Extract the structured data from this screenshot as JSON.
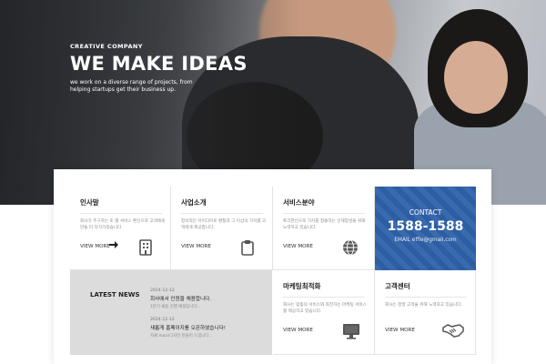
{
  "hero": {
    "eyebrow": "CREATIVE COMPANY",
    "headline": "WE MAKE IDEAS",
    "subtitle": "we work on a diverse range of projects, from helping startups get their business up."
  },
  "services": [
    {
      "title": "인사말",
      "desc": "회사가 추구하는 또 별 서비스 편신으로 고객에게 만들 더 다가가겠습니다.",
      "more": "VIEW MORE",
      "icon": "building-icon"
    },
    {
      "title": "사업소개",
      "desc": "창의적인 아이디어로 편철과 그 이상의 가치를 고객에게 제공합니다.",
      "more": "VIEW MORE",
      "icon": "clipboard-icon"
    },
    {
      "title": "서비스분야",
      "desc": "토크한인으로 가치를 창출하는 인재양성을 위해 노력하고 있습니다.",
      "more": "VIEW MORE",
      "icon": "globe-icon"
    }
  ],
  "contact": {
    "title": "CONTACT",
    "phone": "1588-1588",
    "email": "EMAIL effie@gmail.com"
  },
  "news": {
    "title": "LATEST NEWS",
    "items": [
      {
        "date": "2024-12-12",
        "headline": "회사에서 인원을 채용합니다.",
        "snippet": "1분기 채용 진행 예정입니다..."
      },
      {
        "date": "2024-12-12",
        "headline": "새롭게 홈페이지를 오픈하였습니다!",
        "snippet": "자세 macs디자인 만들어 드립니다..."
      }
    ]
  },
  "more_services": [
    {
      "title": "마케팅최적화",
      "desc": "회사는 맞춤의 서비스와 최전하는 마케팅 서비스를 제공하고 있습니다.",
      "more": "VIEW MORE",
      "icon": "monitor-icon"
    },
    {
      "title": "고객센터",
      "desc": "회사는 정말 고객을 위해 노력하고 있습니다.",
      "more": "VIEW MORE",
      "icon": "handshake-icon"
    }
  ],
  "colors": {
    "accent": "#2f62aa",
    "news_bg": "#dcdcdc"
  }
}
